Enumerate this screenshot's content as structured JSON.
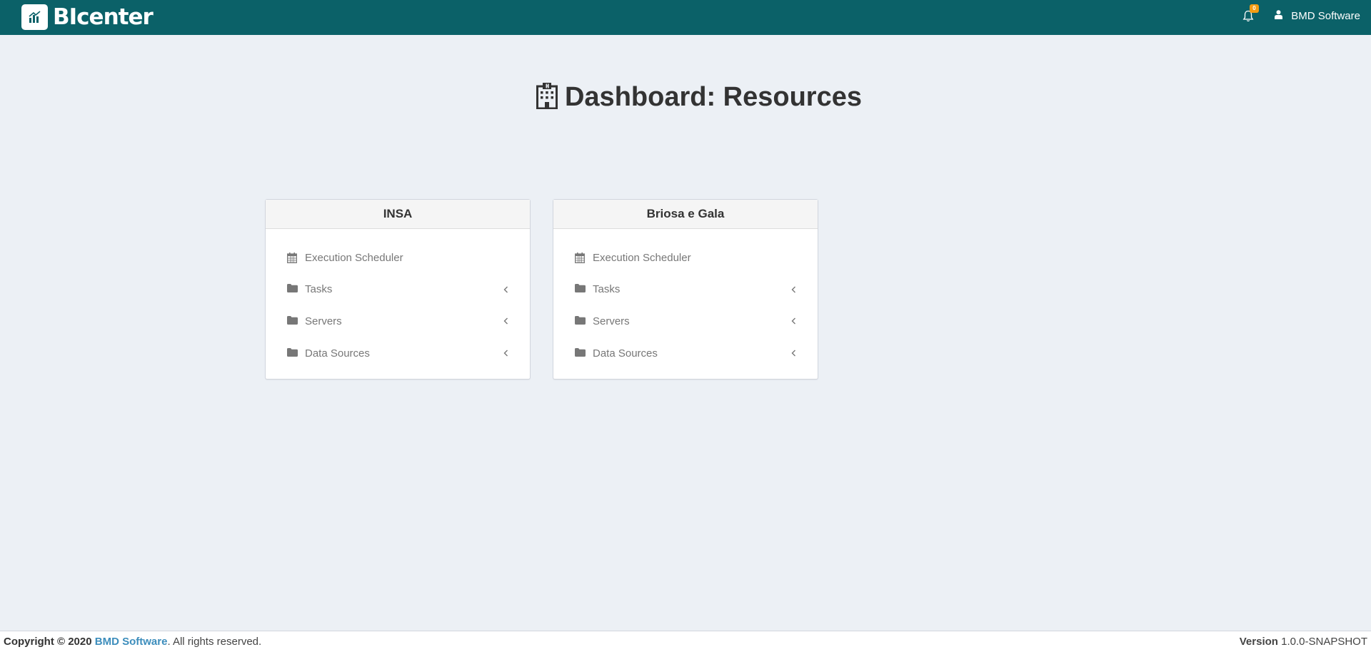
{
  "header": {
    "brand": "BIcenter",
    "notification_count": "0",
    "user_name": "BMD Software"
  },
  "page": {
    "title": "Dashboard: Resources"
  },
  "cards": [
    {
      "title": "INSA",
      "items": [
        {
          "label": "Execution Scheduler",
          "icon": "calendar-icon",
          "expandable": false
        },
        {
          "label": "Tasks",
          "icon": "folder-icon",
          "expandable": true
        },
        {
          "label": "Servers",
          "icon": "folder-icon",
          "expandable": true
        },
        {
          "label": "Data Sources",
          "icon": "folder-icon",
          "expandable": true
        }
      ]
    },
    {
      "title": "Briosa e Gala",
      "items": [
        {
          "label": "Execution Scheduler",
          "icon": "calendar-icon",
          "expandable": false
        },
        {
          "label": "Tasks",
          "icon": "folder-icon",
          "expandable": true
        },
        {
          "label": "Servers",
          "icon": "folder-icon",
          "expandable": true
        },
        {
          "label": "Data Sources",
          "icon": "folder-icon",
          "expandable": true
        }
      ]
    }
  ],
  "footer": {
    "copyright_prefix": "Copyright © 2020",
    "company_link": "BMD Software",
    "rights": ". All rights reserved.",
    "version_label": "Version",
    "version_value": "1.0.0-SNAPSHOT"
  },
  "colors": {
    "header_bg": "#0b6168",
    "page_bg": "#ecf0f5",
    "badge": "#f39c12",
    "link": "#3c8dbc"
  }
}
